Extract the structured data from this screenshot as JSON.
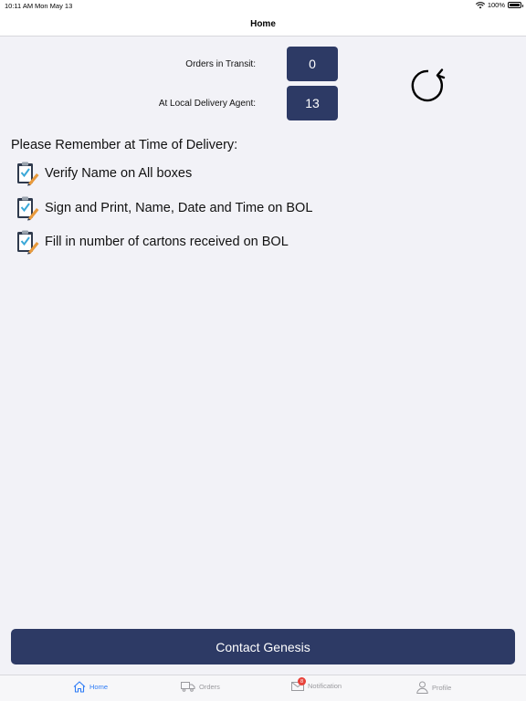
{
  "status_bar": {
    "time": "10:11 AM",
    "date": "Mon May 13",
    "battery": "100%",
    "icons": [
      "wifi-icon",
      "battery-icon"
    ]
  },
  "nav": {
    "title": "Home"
  },
  "stats": {
    "in_transit_label": "Orders in Transit:",
    "in_transit_value": "0",
    "local_agent_label": "At Local Delivery Agent:",
    "local_agent_value": "13"
  },
  "reminder": {
    "title": "Please Remember at Time of Delivery:",
    "items": [
      {
        "icon": "clipboard-check-icon",
        "text": "Verify Name on All boxes"
      },
      {
        "icon": "clipboard-check-icon",
        "text": "Sign and Print, Name, Date and Time on BOL"
      },
      {
        "icon": "clipboard-check-icon",
        "text": "Fill in number of cartons received on BOL"
      }
    ]
  },
  "contact_button": {
    "label": "Contact Genesis"
  },
  "tabbar": {
    "tabs": [
      {
        "label": "Home",
        "icon": "home-icon",
        "active": true
      },
      {
        "label": "Orders",
        "icon": "truck-icon",
        "active": false
      },
      {
        "label": "Notification",
        "icon": "envelope-icon",
        "active": false,
        "badge": "8"
      },
      {
        "label": "Profile",
        "icon": "person-icon",
        "active": false
      }
    ]
  },
  "colors": {
    "accent_navy": "#2d3a65",
    "tab_active": "#2e7cf6",
    "tab_inactive": "#9a9a9e",
    "badge_red": "#e8423a",
    "background": "#f2f2f7"
  }
}
